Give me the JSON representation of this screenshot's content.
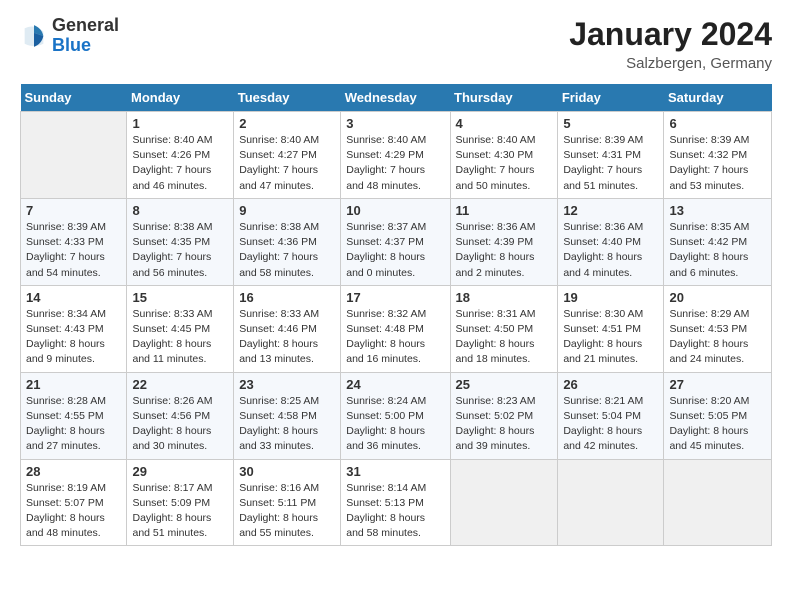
{
  "header": {
    "logo_general": "General",
    "logo_blue": "Blue",
    "month_year": "January 2024",
    "location": "Salzbergen, Germany"
  },
  "days_of_week": [
    "Sunday",
    "Monday",
    "Tuesday",
    "Wednesday",
    "Thursday",
    "Friday",
    "Saturday"
  ],
  "weeks": [
    [
      {
        "day": null
      },
      {
        "day": 1,
        "sunrise": "Sunrise: 8:40 AM",
        "sunset": "Sunset: 4:26 PM",
        "daylight": "Daylight: 7 hours and 46 minutes."
      },
      {
        "day": 2,
        "sunrise": "Sunrise: 8:40 AM",
        "sunset": "Sunset: 4:27 PM",
        "daylight": "Daylight: 7 hours and 47 minutes."
      },
      {
        "day": 3,
        "sunrise": "Sunrise: 8:40 AM",
        "sunset": "Sunset: 4:29 PM",
        "daylight": "Daylight: 7 hours and 48 minutes."
      },
      {
        "day": 4,
        "sunrise": "Sunrise: 8:40 AM",
        "sunset": "Sunset: 4:30 PM",
        "daylight": "Daylight: 7 hours and 50 minutes."
      },
      {
        "day": 5,
        "sunrise": "Sunrise: 8:39 AM",
        "sunset": "Sunset: 4:31 PM",
        "daylight": "Daylight: 7 hours and 51 minutes."
      },
      {
        "day": 6,
        "sunrise": "Sunrise: 8:39 AM",
        "sunset": "Sunset: 4:32 PM",
        "daylight": "Daylight: 7 hours and 53 minutes."
      }
    ],
    [
      {
        "day": 7,
        "sunrise": "Sunrise: 8:39 AM",
        "sunset": "Sunset: 4:33 PM",
        "daylight": "Daylight: 7 hours and 54 minutes."
      },
      {
        "day": 8,
        "sunrise": "Sunrise: 8:38 AM",
        "sunset": "Sunset: 4:35 PM",
        "daylight": "Daylight: 7 hours and 56 minutes."
      },
      {
        "day": 9,
        "sunrise": "Sunrise: 8:38 AM",
        "sunset": "Sunset: 4:36 PM",
        "daylight": "Daylight: 7 hours and 58 minutes."
      },
      {
        "day": 10,
        "sunrise": "Sunrise: 8:37 AM",
        "sunset": "Sunset: 4:37 PM",
        "daylight": "Daylight: 8 hours and 0 minutes."
      },
      {
        "day": 11,
        "sunrise": "Sunrise: 8:36 AM",
        "sunset": "Sunset: 4:39 PM",
        "daylight": "Daylight: 8 hours and 2 minutes."
      },
      {
        "day": 12,
        "sunrise": "Sunrise: 8:36 AM",
        "sunset": "Sunset: 4:40 PM",
        "daylight": "Daylight: 8 hours and 4 minutes."
      },
      {
        "day": 13,
        "sunrise": "Sunrise: 8:35 AM",
        "sunset": "Sunset: 4:42 PM",
        "daylight": "Daylight: 8 hours and 6 minutes."
      }
    ],
    [
      {
        "day": 14,
        "sunrise": "Sunrise: 8:34 AM",
        "sunset": "Sunset: 4:43 PM",
        "daylight": "Daylight: 8 hours and 9 minutes."
      },
      {
        "day": 15,
        "sunrise": "Sunrise: 8:33 AM",
        "sunset": "Sunset: 4:45 PM",
        "daylight": "Daylight: 8 hours and 11 minutes."
      },
      {
        "day": 16,
        "sunrise": "Sunrise: 8:33 AM",
        "sunset": "Sunset: 4:46 PM",
        "daylight": "Daylight: 8 hours and 13 minutes."
      },
      {
        "day": 17,
        "sunrise": "Sunrise: 8:32 AM",
        "sunset": "Sunset: 4:48 PM",
        "daylight": "Daylight: 8 hours and 16 minutes."
      },
      {
        "day": 18,
        "sunrise": "Sunrise: 8:31 AM",
        "sunset": "Sunset: 4:50 PM",
        "daylight": "Daylight: 8 hours and 18 minutes."
      },
      {
        "day": 19,
        "sunrise": "Sunrise: 8:30 AM",
        "sunset": "Sunset: 4:51 PM",
        "daylight": "Daylight: 8 hours and 21 minutes."
      },
      {
        "day": 20,
        "sunrise": "Sunrise: 8:29 AM",
        "sunset": "Sunset: 4:53 PM",
        "daylight": "Daylight: 8 hours and 24 minutes."
      }
    ],
    [
      {
        "day": 21,
        "sunrise": "Sunrise: 8:28 AM",
        "sunset": "Sunset: 4:55 PM",
        "daylight": "Daylight: 8 hours and 27 minutes."
      },
      {
        "day": 22,
        "sunrise": "Sunrise: 8:26 AM",
        "sunset": "Sunset: 4:56 PM",
        "daylight": "Daylight: 8 hours and 30 minutes."
      },
      {
        "day": 23,
        "sunrise": "Sunrise: 8:25 AM",
        "sunset": "Sunset: 4:58 PM",
        "daylight": "Daylight: 8 hours and 33 minutes."
      },
      {
        "day": 24,
        "sunrise": "Sunrise: 8:24 AM",
        "sunset": "Sunset: 5:00 PM",
        "daylight": "Daylight: 8 hours and 36 minutes."
      },
      {
        "day": 25,
        "sunrise": "Sunrise: 8:23 AM",
        "sunset": "Sunset: 5:02 PM",
        "daylight": "Daylight: 8 hours and 39 minutes."
      },
      {
        "day": 26,
        "sunrise": "Sunrise: 8:21 AM",
        "sunset": "Sunset: 5:04 PM",
        "daylight": "Daylight: 8 hours and 42 minutes."
      },
      {
        "day": 27,
        "sunrise": "Sunrise: 8:20 AM",
        "sunset": "Sunset: 5:05 PM",
        "daylight": "Daylight: 8 hours and 45 minutes."
      }
    ],
    [
      {
        "day": 28,
        "sunrise": "Sunrise: 8:19 AM",
        "sunset": "Sunset: 5:07 PM",
        "daylight": "Daylight: 8 hours and 48 minutes."
      },
      {
        "day": 29,
        "sunrise": "Sunrise: 8:17 AM",
        "sunset": "Sunset: 5:09 PM",
        "daylight": "Daylight: 8 hours and 51 minutes."
      },
      {
        "day": 30,
        "sunrise": "Sunrise: 8:16 AM",
        "sunset": "Sunset: 5:11 PM",
        "daylight": "Daylight: 8 hours and 55 minutes."
      },
      {
        "day": 31,
        "sunrise": "Sunrise: 8:14 AM",
        "sunset": "Sunset: 5:13 PM",
        "daylight": "Daylight: 8 hours and 58 minutes."
      },
      {
        "day": null
      },
      {
        "day": null
      },
      {
        "day": null
      }
    ]
  ]
}
